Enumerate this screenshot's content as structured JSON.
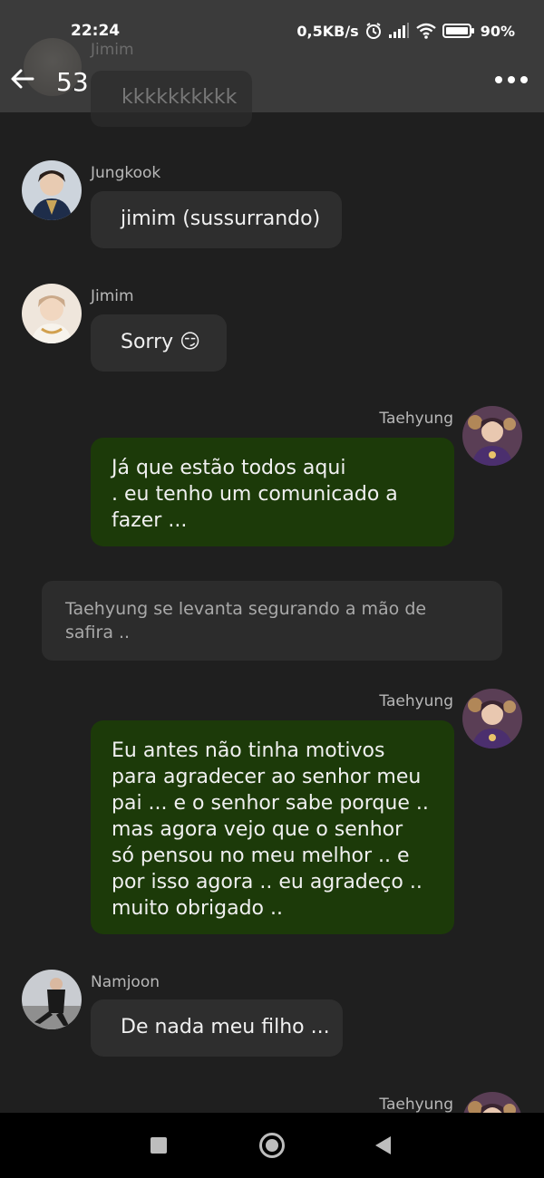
{
  "status_bar": {
    "time": "22:24",
    "network_speed": "0,5KB/s",
    "battery": "90%"
  },
  "header": {
    "count": "53",
    "back_icon": "arrow-left-icon",
    "menu_icon": "more-horizontal-icon"
  },
  "scrolled_message": {
    "name": "Jimim",
    "text": "kkkkkkkkkk"
  },
  "messages": [
    {
      "side": "left",
      "name": "Jungkook",
      "text": "jimim (sussurrando)"
    },
    {
      "side": "left",
      "name": "Jimim",
      "text": "Sorry 😏"
    },
    {
      "side": "right",
      "name": "Taehyung",
      "text": "Já que estão todos aqui\n. eu tenho um comunicado a\nfazer ..."
    },
    {
      "type": "narration",
      "text": "Taehyung se levanta segurando a mão de\nsafira .."
    },
    {
      "side": "right",
      "name": "Taehyung",
      "text": "Eu antes não tinha motivos\npara agradecer ao senhor meu\npai ... e o senhor sabe porque ..\nmas agora vejo que o senhor\nsó pensou no meu melhor .. e\npor isso agora .. eu agradeço ..\nmuito obrigado .."
    },
    {
      "side": "left",
      "name": "Namjoon",
      "text": "De nada meu filho ..."
    },
    {
      "side": "right",
      "name": "Taehyung",
      "text": ""
    }
  ],
  "colors": {
    "background": "#1f1f1f",
    "header": "#3b3b3b",
    "bubble_dark": "#2e2e2e",
    "bubble_green": "#1c3a09",
    "name": "#b8b8b8"
  },
  "nav_bar": {
    "icons": [
      "square-recents-icon",
      "circle-home-icon",
      "triangle-back-icon"
    ]
  }
}
